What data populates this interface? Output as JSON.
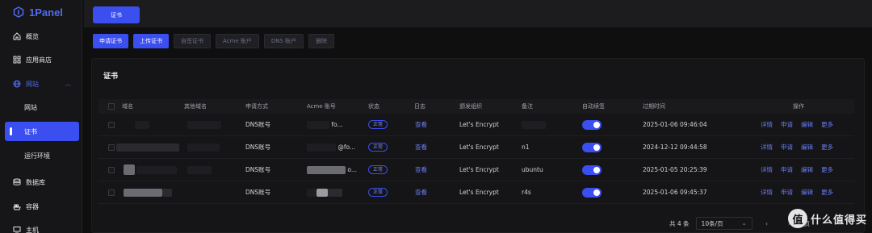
{
  "app": {
    "logo_text": "1Panel"
  },
  "sidebar": {
    "items": [
      {
        "label": "概览"
      },
      {
        "label": "应用商店"
      },
      {
        "label": "网站"
      },
      {
        "label": "网站"
      },
      {
        "label": "证书"
      },
      {
        "label": "运行环境"
      },
      {
        "label": "数据库"
      },
      {
        "label": "容器"
      },
      {
        "label": "主机"
      }
    ]
  },
  "tabs": {
    "active": "证书"
  },
  "toolbar": {
    "apply": "申请证书",
    "upload": "上传证书",
    "self_signed": "自签证书",
    "acme": "Acme 账户",
    "dns": "DNS 账户",
    "delete": "删除"
  },
  "card": {
    "title": "证书"
  },
  "table": {
    "headers": {
      "domain": "域名",
      "other_domains": "其他域名",
      "method": "申请方式",
      "acme_account": "Acme 账号",
      "status": "状态",
      "log": "日志",
      "issuer": "颁发组织",
      "remark": "备注",
      "auto_renew": "自动续签",
      "expire": "过期时间",
      "ops": "操作"
    },
    "rows": [
      {
        "method": "DNS账号",
        "acme_suffix": "fo...",
        "status": "正常",
        "log": "查看",
        "issuer": "Let's Encrypt",
        "remark": "",
        "auto_renew": true,
        "expire": "2025-01-06 09:46:04"
      },
      {
        "method": "DNS账号",
        "acme_suffix": "@fo...",
        "status": "正常",
        "log": "查看",
        "issuer": "Let's Encrypt",
        "remark": "n1",
        "auto_renew": true,
        "expire": "2024-12-12 09:44:58"
      },
      {
        "method": "DNS账号",
        "acme_suffix": "o...",
        "status": "正常",
        "log": "查看",
        "issuer": "Let's Encrypt",
        "remark": "ubuntu",
        "auto_renew": true,
        "expire": "2025-01-05 20:25:39"
      },
      {
        "method": "DNS账号",
        "acme_suffix": "",
        "status": "正常",
        "log": "查看",
        "issuer": "Let's Encrypt",
        "remark": "r4s",
        "auto_renew": true,
        "expire": "2025-01-06 09:45:37"
      }
    ],
    "ops": {
      "detail": "详情",
      "apply": "申请",
      "edit": "编辑",
      "more": "更多"
    }
  },
  "pagination": {
    "total": "共 4 条",
    "page_size": "10条/页",
    "next_fragment": "页"
  },
  "watermark": {
    "icon": "值",
    "text": "什么值得买"
  },
  "colors": {
    "accent": "#3b4ef0",
    "background": "#0f0f10"
  }
}
